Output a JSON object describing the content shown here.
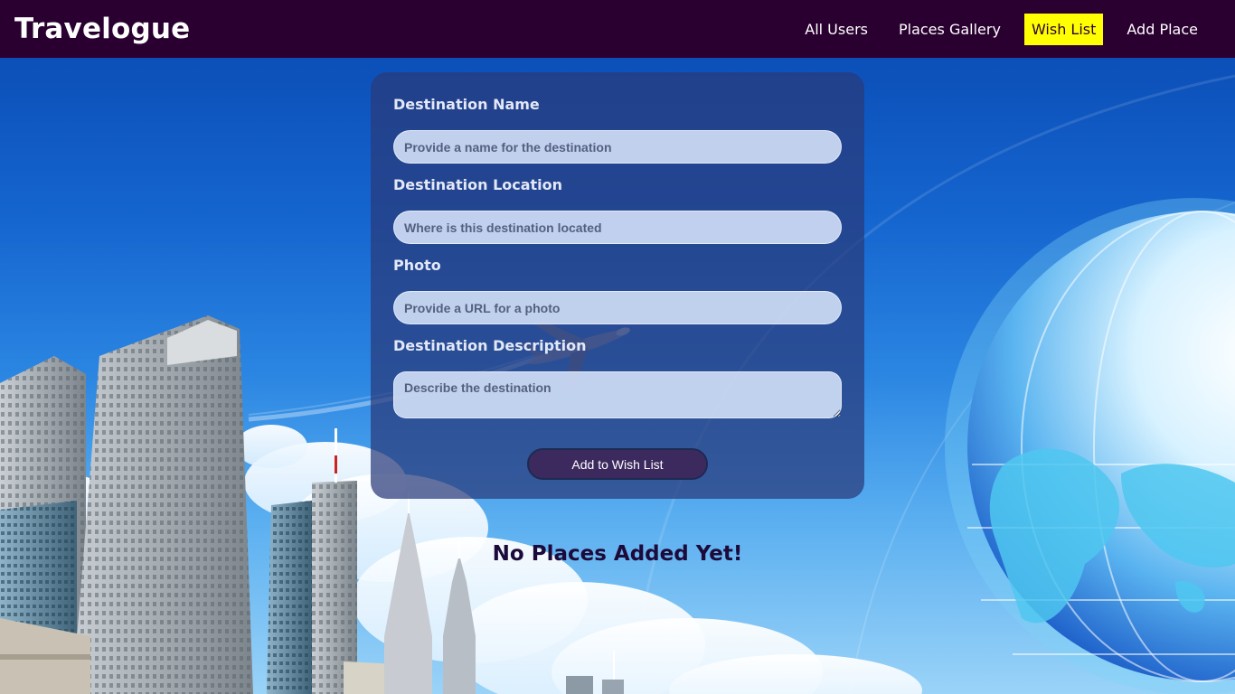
{
  "brand": {
    "title": "Travelogue"
  },
  "nav": {
    "links": [
      {
        "label": "All Users",
        "active": false
      },
      {
        "label": "Places Gallery",
        "active": false
      },
      {
        "label": "Wish List",
        "active": true
      },
      {
        "label": "Add Place",
        "active": false
      }
    ]
  },
  "form": {
    "name": {
      "label": "Destination Name",
      "placeholder": "Provide a name for the destination",
      "value": ""
    },
    "location": {
      "label": "Destination Location",
      "placeholder": "Where is this destination located",
      "value": ""
    },
    "photo": {
      "label": "Photo",
      "placeholder": "Provide a URL for a photo",
      "value": ""
    },
    "description": {
      "label": "Destination Description",
      "placeholder": "Describe the destination",
      "value": ""
    },
    "submit_label": "Add to Wish List"
  },
  "empty_message": "No Places Added Yet!",
  "colors": {
    "navbar_bg": "#2a0030",
    "nav_active_bg": "#ffff00",
    "card_bg": "rgba(42, 58, 122, 0.72)",
    "button_bg": "#3c2a5e",
    "message_text": "#1c0a3a"
  }
}
